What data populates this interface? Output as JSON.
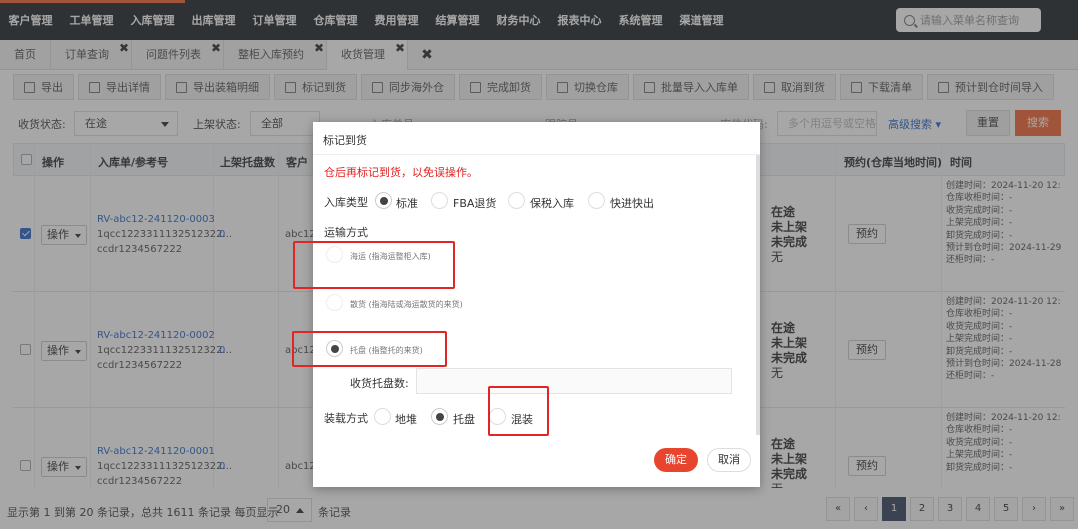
{
  "topnav": {
    "menu": [
      "客户管理",
      "工单管理",
      "入库管理",
      "出库管理",
      "订单管理",
      "仓库管理",
      "费用管理",
      "结算管理",
      "财务中心",
      "报表中心",
      "系统管理",
      "渠道管理"
    ],
    "search_placeholder": "请输入菜单名称查询",
    "accent_color": "#f26b3a"
  },
  "tabs": {
    "items": [
      {
        "label": "首页",
        "closable": false
      },
      {
        "label": "订单查询",
        "closable": true
      },
      {
        "label": "问题件列表",
        "closable": true
      },
      {
        "label": "整柜入库预约",
        "closable": true
      },
      {
        "label": "收货管理",
        "closable": true,
        "active": true
      }
    ],
    "close_all": "✖"
  },
  "toolbar": {
    "buttons": [
      "导出",
      "导出详情",
      "导出装箱明细",
      "标记到货",
      "同步海外仓",
      "完成卸货",
      "切换仓库",
      "批量导入入库单",
      "取消到货",
      "下载清单",
      "预计到仓时间导入"
    ]
  },
  "filter": {
    "receive_status_label": "收货状态:",
    "receive_status_value": "在途",
    "shelf_status_label": "上架状态:",
    "shelf_status_value": "全部",
    "inbound_no_label": "入库单号",
    "tracking_label": "跟踪号",
    "location_label": "库位代码:",
    "multi_placeholder": "多个用逗号或空格",
    "advanced_label": "高级搜索",
    "reset_label": "重置",
    "search_label": "搜索"
  },
  "table": {
    "headers": {
      "op": "操作",
      "inbound": "入库单/参考号",
      "shelf_boxes": "上架托盘数",
      "customer": "客户",
      "appointment": "预约(仓库当地时间)",
      "time": "时间"
    },
    "op_label": "操作",
    "appointment_label": "预约",
    "rows": [
      {
        "checked": true,
        "inbound_no": "RV-abc12-241120-0003",
        "ref1": "1qcc1223311132512322...",
        "ref2": "ccdr1234567222",
        "shelf": "0",
        "customer": "abc12",
        "status": [
          "在途",
          "未上架",
          "未完成",
          "无"
        ],
        "times": [
          "创建时间：2024-11-20 12:",
          "仓库收柜时间：-",
          "收货完成时间：-",
          "上架完成时间：-",
          "卸货完成时间：-",
          "预计到仓时间：2024-11-29",
          "还柜时间：-"
        ]
      },
      {
        "checked": false,
        "inbound_no": "RV-abc12-241120-0002",
        "ref1": "1qcc1223311132512322...",
        "ref2": "ccdr1234567222",
        "shelf": "0",
        "customer": "abc12",
        "status": [
          "在途",
          "未上架",
          "未完成",
          "无"
        ],
        "times": [
          "创建时间：2024-11-20 12:",
          "仓库收柜时间：-",
          "收货完成时间：-",
          "上架完成时间：-",
          "卸货完成时间：-",
          "预计到仓时间：2024-11-28",
          "还柜时间：-"
        ]
      },
      {
        "checked": false,
        "inbound_no": "RV-abc12-241120-0001",
        "ref1": "1qcc1223311132512322...",
        "ref2": "ccdr1234567222",
        "shelf": "0",
        "customer": "abc12",
        "status": [
          "在途",
          "未上架",
          "未完成",
          "无"
        ],
        "times": [
          "创建时间：2024-11-20 12:",
          "仓库收柜时间：-",
          "收货完成时间：-",
          "上架完成时间：-",
          "卸货完成时间：-"
        ]
      }
    ]
  },
  "footer": {
    "info": "显示第 1 到第 20 条记录，总共 1611 条记录 每页显示",
    "page_size": "20",
    "unit": "条记录",
    "pages": [
      "«",
      "‹",
      "1",
      "2",
      "3",
      "4",
      "5",
      "›",
      "»"
    ],
    "active_page": "1"
  },
  "modal": {
    "title": "标记到货",
    "warning": "仓后再标记到货，以免误操作。",
    "inbound_type_label": "入库类型",
    "inbound_types": [
      {
        "label": "标准",
        "selected": true
      },
      {
        "label": "FBA退货",
        "selected": false
      },
      {
        "label": "保税入库",
        "selected": false
      },
      {
        "label": "快进快出",
        "selected": false
      }
    ],
    "transport_label": "运输方式",
    "transports": [
      {
        "label": "海运 (指海运整柜入库)",
        "selected": false
      },
      {
        "label": "散货 (指海陆或海运散货的来货)",
        "selected": false
      },
      {
        "label": "托盘 (指整托的来货)",
        "selected": true
      }
    ],
    "pallet_count_label": "收货托盘数:",
    "pallet_count_value": "",
    "loading_label": "装载方式",
    "loadings": [
      {
        "label": "地堆",
        "selected": false
      },
      {
        "label": "托盘",
        "selected": true
      },
      {
        "label": "混装",
        "selected": false
      }
    ],
    "ok_label": "确定",
    "cancel_label": "取消",
    "highlight_color": "#e02525"
  }
}
